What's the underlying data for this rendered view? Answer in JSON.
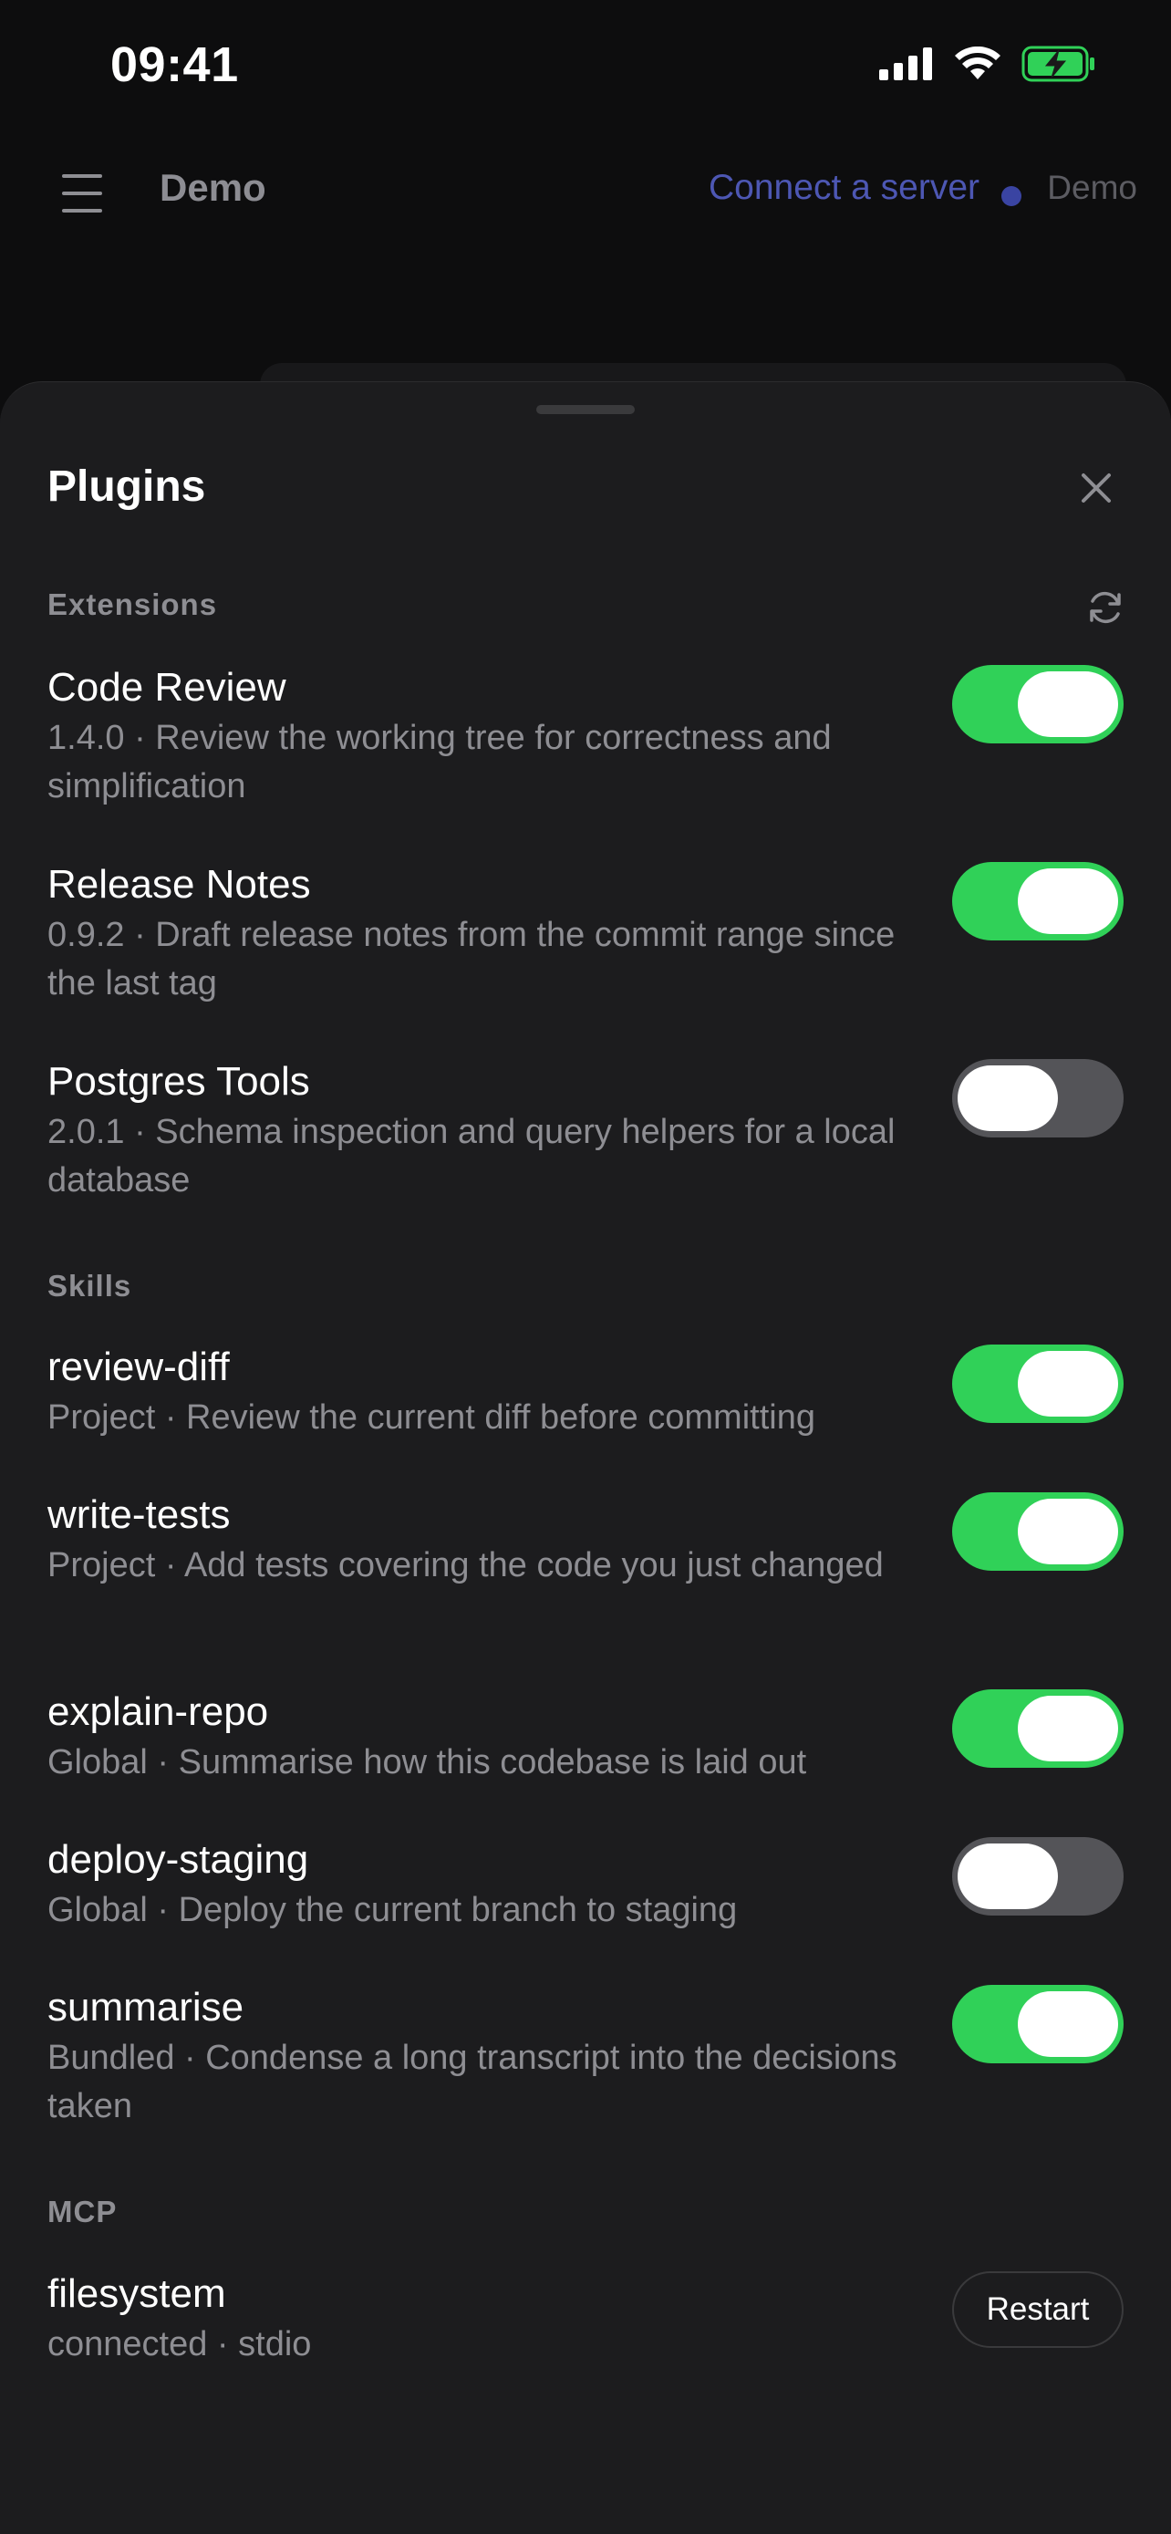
{
  "status_bar": {
    "time": "09:41"
  },
  "header": {
    "title": "Demo",
    "connect_label": "Connect a server",
    "server_label": "Demo"
  },
  "sheet": {
    "title": "Plugins",
    "sections": {
      "extensions": {
        "label": "Extensions",
        "items": [
          {
            "name": "Code Review",
            "desc": "1.4.0 · Review the working tree for correctness and simplification",
            "enabled": true
          },
          {
            "name": "Release Notes",
            "desc": "0.9.2 · Draft release notes from the commit range since the last tag",
            "enabled": true
          },
          {
            "name": "Postgres Tools",
            "desc": "2.0.1 · Schema inspection and query helpers for a local database",
            "enabled": false
          }
        ]
      },
      "skills": {
        "label": "Skills",
        "items": [
          {
            "name": "review-diff",
            "desc": "Project · Review the current diff before committing",
            "enabled": true
          },
          {
            "name": "write-tests",
            "desc": "Project · Add tests covering the code you just changed",
            "enabled": true
          },
          {
            "name": "explain-repo",
            "desc": "Global · Summarise how this codebase is laid out",
            "enabled": true
          },
          {
            "name": "deploy-staging",
            "desc": "Global · Deploy the current branch to staging",
            "enabled": false
          },
          {
            "name": "summarise",
            "desc": "Bundled · Condense a long transcript into the decisions taken",
            "enabled": true
          }
        ]
      },
      "mcp": {
        "label": "MCP",
        "items": [
          {
            "name": "filesystem",
            "desc": "connected · stdio",
            "action_label": "Restart"
          }
        ]
      }
    }
  },
  "colors": {
    "toggle_on": "#30d158",
    "toggle_off": "#545458",
    "accent_link": "#4d57b3",
    "sheet_bg": "#1c1c1e"
  }
}
